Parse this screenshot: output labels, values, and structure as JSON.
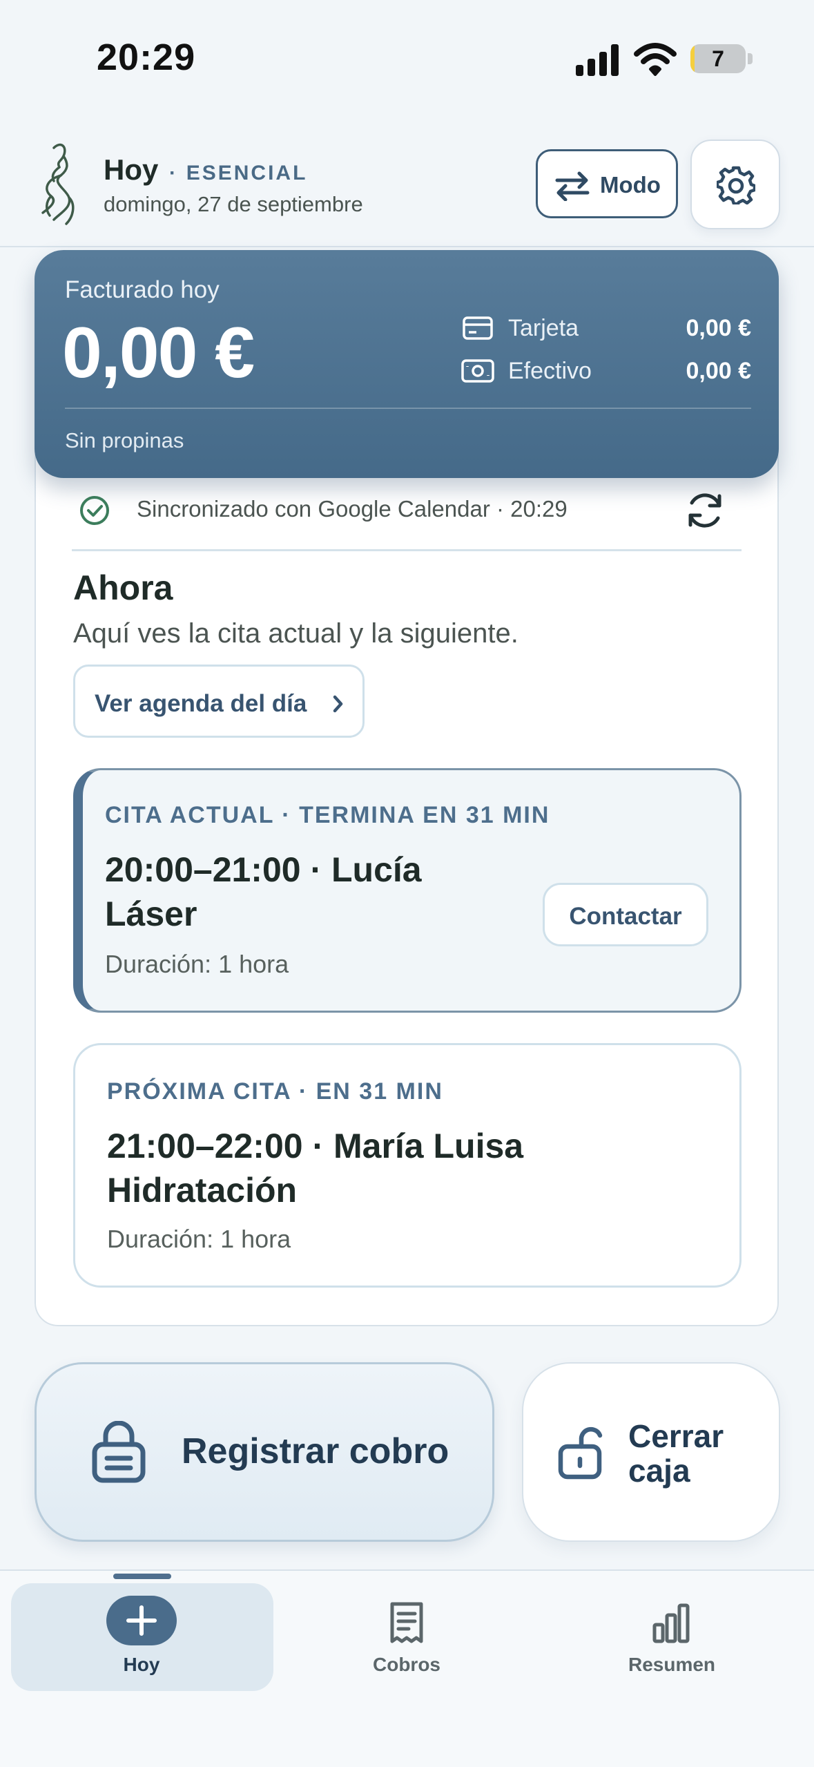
{
  "status_bar": {
    "time": "20:29",
    "battery_level": "7",
    "battery_fraction": 0.07
  },
  "header": {
    "title": "Hoy",
    "separator": "·",
    "plan": "ESENCIAL",
    "date": "domingo, 27 de septiembre",
    "mode_button": "Modo"
  },
  "earnings": {
    "label": "Facturado hoy",
    "amount": "0,00 €",
    "card_label": "Tarjeta",
    "card_value": "0,00 €",
    "cash_label": "Efectivo",
    "cash_value": "0,00 €",
    "tips": "Sin propinas"
  },
  "sync": {
    "text": "Sincronizado con Google Calendar · 20:29"
  },
  "now_section": {
    "title": "Ahora",
    "subtitle": "Aquí ves la cita actual y la siguiente.",
    "agenda_button": "Ver agenda del día"
  },
  "current_appointment": {
    "tag": "CITA ACTUAL · TERMINA EN 31 MIN",
    "title_line1": "20:00–21:00 · Lucía",
    "title_line2": "Láser",
    "duration": "Duración: 1 hora",
    "contact_button": "Contactar"
  },
  "next_appointment": {
    "tag": "PRÓXIMA CITA · EN 31 MIN",
    "title_line1": "21:00–22:00 · María Luisa",
    "title_line2": "Hidratación",
    "duration": "Duración: 1 hora"
  },
  "actions": {
    "register": "Registrar cobro",
    "close_line1": "Cerrar",
    "close_line2": "caja"
  },
  "tabs": [
    {
      "label": "Hoy",
      "icon": "plus-icon",
      "active": true
    },
    {
      "label": "Cobros",
      "icon": "receipt-icon",
      "active": false
    },
    {
      "label": "Resumen",
      "icon": "bar-chart-icon",
      "active": false
    }
  ],
  "colors": {
    "accent": "#4a6c8b",
    "accent_dark": "#233b52",
    "success": "#3c7d5c"
  }
}
